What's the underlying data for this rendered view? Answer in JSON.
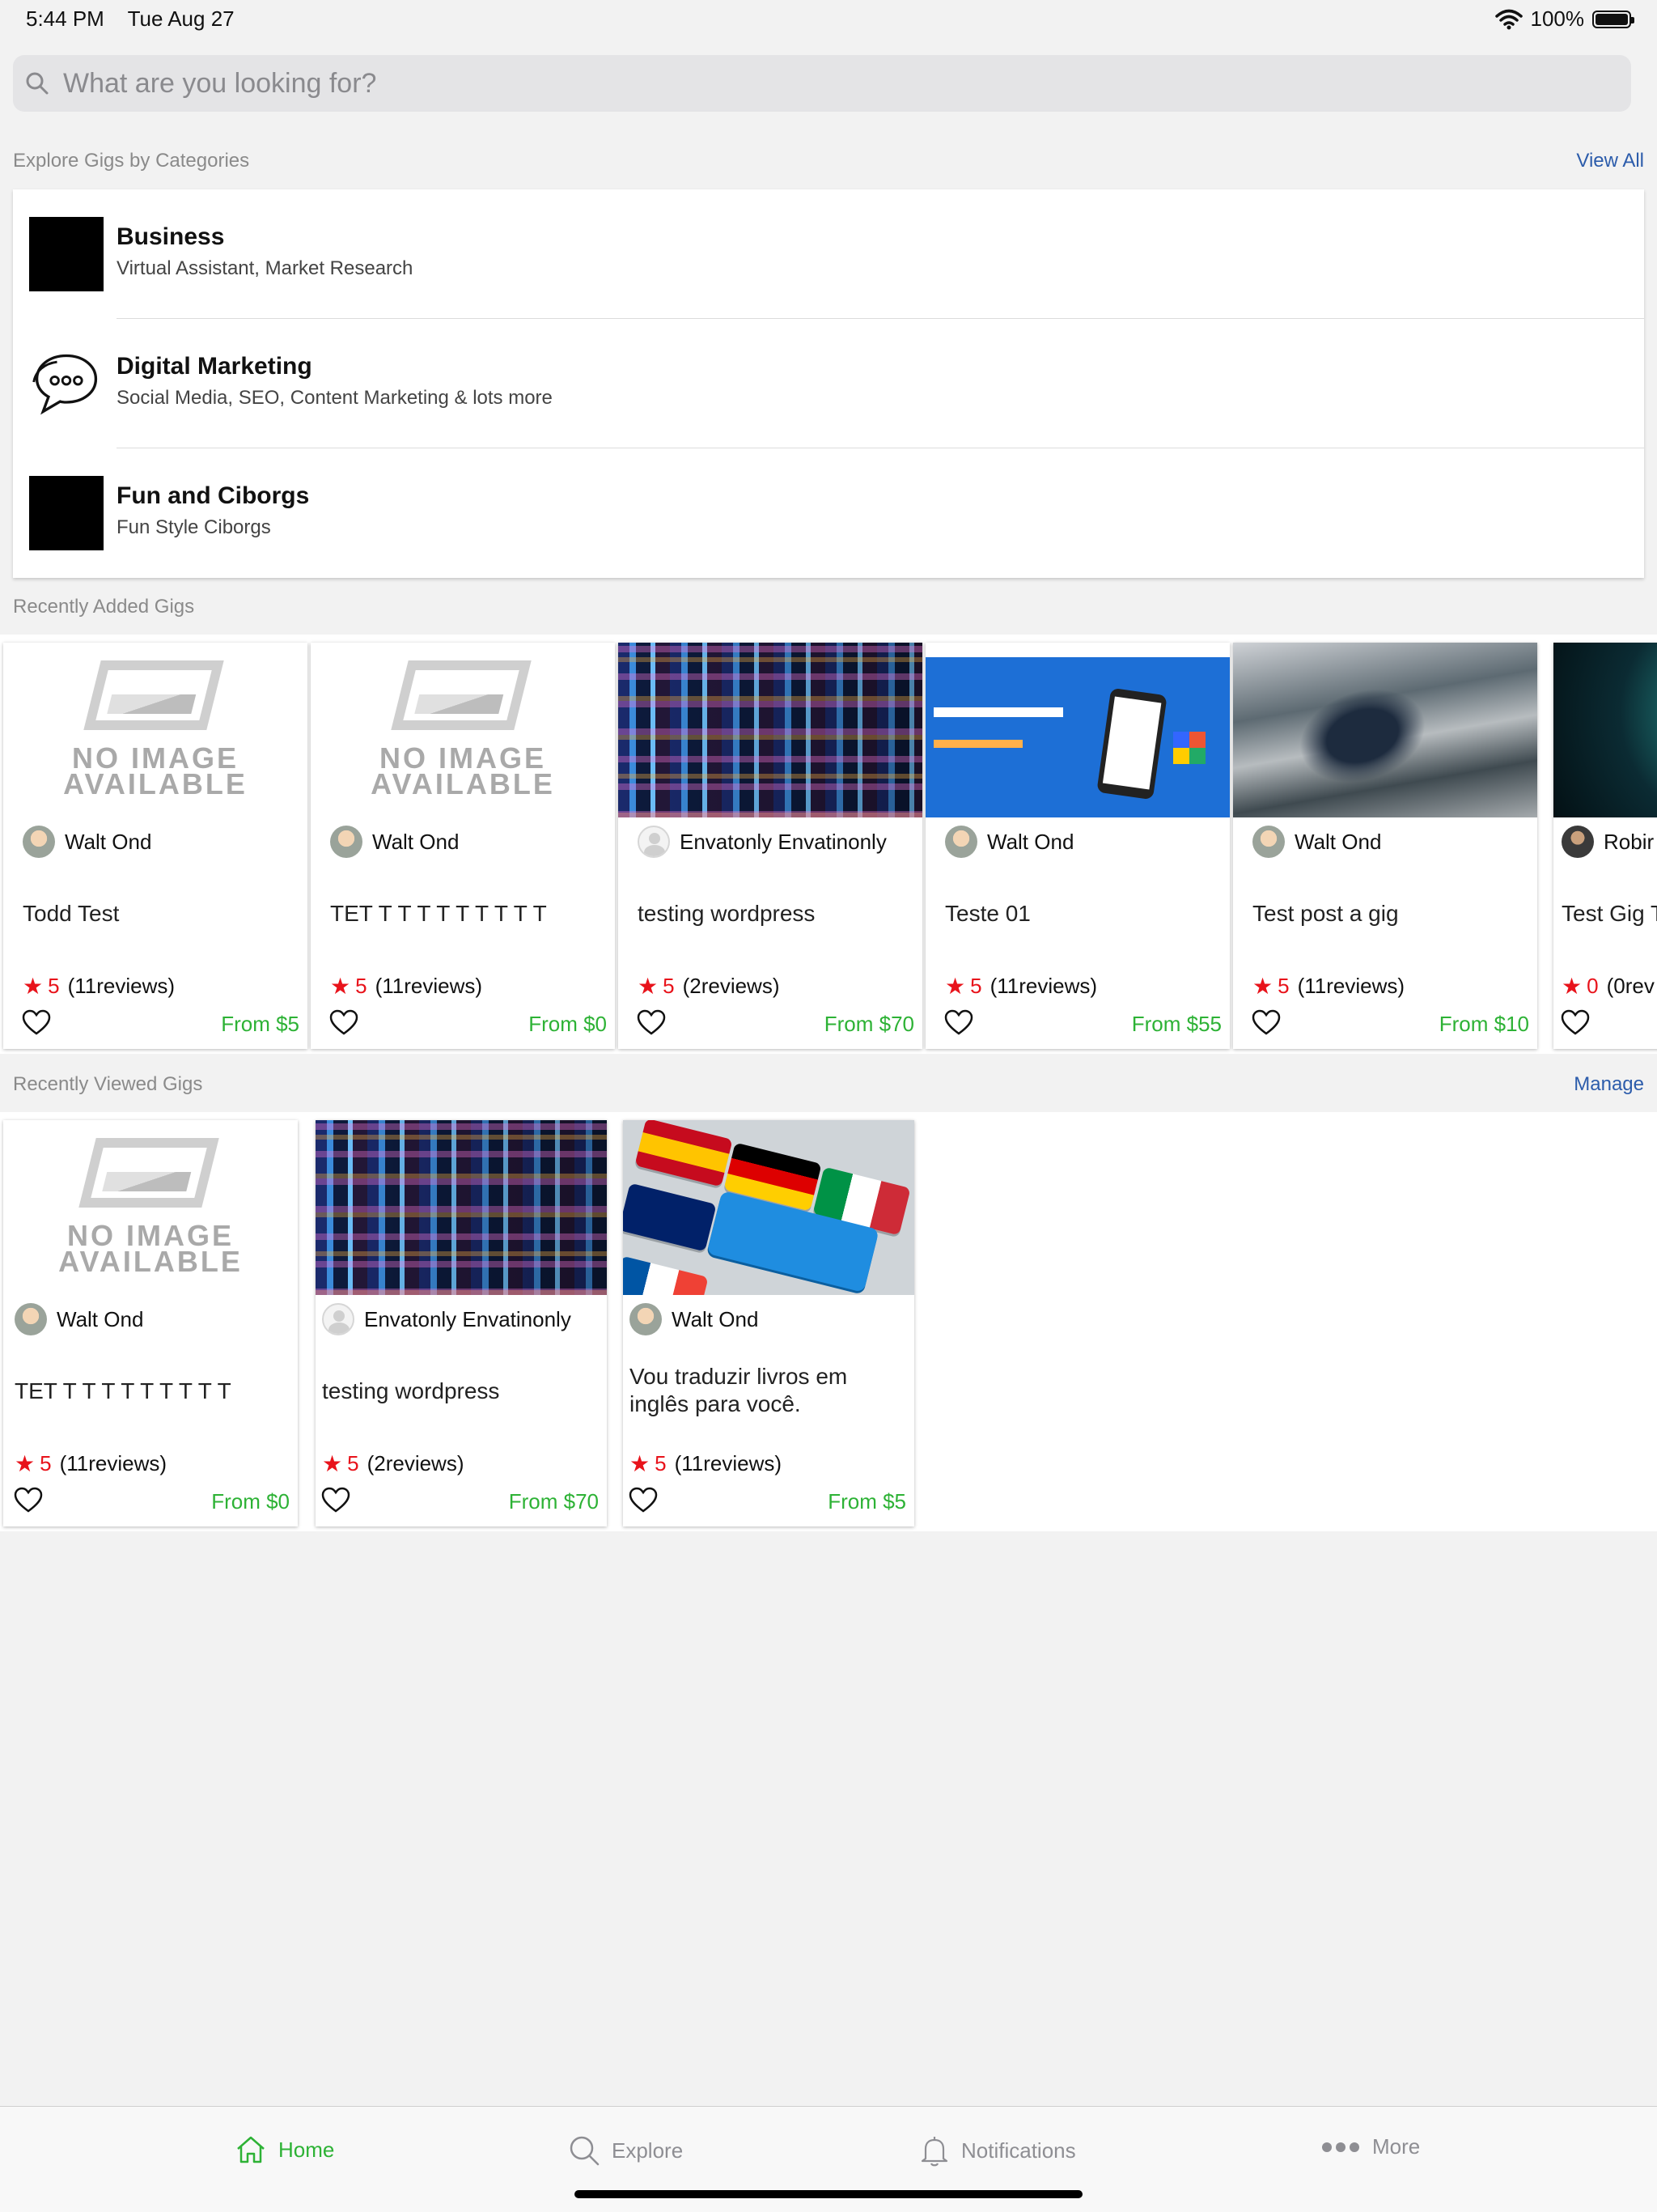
{
  "status_bar": {
    "time": "5:44 PM",
    "date": "Tue Aug 27",
    "battery": "100%"
  },
  "search": {
    "placeholder": "What are you looking for?"
  },
  "categories_section": {
    "title": "Explore Gigs by Categories",
    "link": "View All"
  },
  "categories": [
    {
      "name": "Business",
      "sub": "Virtual Assistant, Market Research"
    },
    {
      "name": "Digital Marketing",
      "sub": "Social Media, SEO, Content Marketing & lots more"
    },
    {
      "name": "Fun and Ciborgs",
      "sub": "Fun Style Ciborgs"
    }
  ],
  "no_image": {
    "line1": "NO IMAGE",
    "line2": "AVAILABLE"
  },
  "recently_added": {
    "title": "Recently Added Gigs",
    "gigs": [
      {
        "author": "Walt Ond",
        "title": "Todd Test",
        "rating": "5",
        "reviews": "(11reviews)",
        "price": "From $5"
      },
      {
        "author": "Walt Ond",
        "title": "TET T T T T T T T T T",
        "rating": "5",
        "reviews": "(11reviews)",
        "price": "From $0"
      },
      {
        "author": "Envatonly Envatinonly",
        "title": "testing wordpress",
        "rating": "5",
        "reviews": "(2reviews)",
        "price": "From $70"
      },
      {
        "author": "Walt Ond",
        "title": "Teste 01",
        "rating": "5",
        "reviews": "(11reviews)",
        "price": "From $55"
      },
      {
        "author": "Walt Ond",
        "title": "Test post a gig",
        "rating": "5",
        "reviews": "(11reviews)",
        "price": "From $10"
      },
      {
        "author": "Robir",
        "title": "Test Gig T",
        "rating": "0",
        "reviews": "(0rev"
      }
    ]
  },
  "recently_viewed": {
    "title": "Recently Viewed Gigs",
    "link": "Manage",
    "gigs": [
      {
        "author": "Walt Ond",
        "title": "TET T T T T T T T T T",
        "rating": "5",
        "reviews": "(11reviews)",
        "price": "From $0"
      },
      {
        "author": "Envatonly Envatinonly",
        "title": "testing wordpress",
        "rating": "5",
        "reviews": "(2reviews)",
        "price": "From $70"
      },
      {
        "author": "Walt Ond",
        "title": "Vou traduzir livros em inglês para você.",
        "rating": "5",
        "reviews": "(11reviews)",
        "price": "From $5"
      }
    ]
  },
  "tabs": [
    {
      "label": "Home",
      "icon": "home-icon",
      "active": true
    },
    {
      "label": "Explore",
      "icon": "search-icon",
      "active": false
    },
    {
      "label": "Notifications",
      "icon": "bell-icon",
      "active": false
    },
    {
      "label": "More",
      "icon": "more-icon",
      "active": false
    }
  ],
  "colors": {
    "accent": "#2db235",
    "link": "#2c5cab",
    "star": "#e8131b"
  }
}
